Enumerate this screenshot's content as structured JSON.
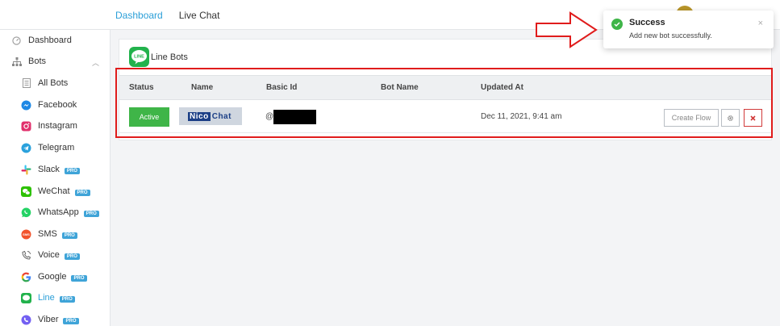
{
  "header": {
    "nav": [
      {
        "label": "Dashboard",
        "active": true
      },
      {
        "label": "Live Chat",
        "active": false
      }
    ]
  },
  "sidebar": {
    "items": [
      {
        "label": "Dashboard",
        "icon": "dashboard-icon"
      },
      {
        "label": "Bots",
        "icon": "sitemap-icon",
        "expanded": true
      },
      {
        "label": "All Bots",
        "icon": "list-icon"
      },
      {
        "label": "Facebook",
        "icon": "messenger-icon"
      },
      {
        "label": "Instagram",
        "icon": "instagram-icon"
      },
      {
        "label": "Telegram",
        "icon": "telegram-icon"
      },
      {
        "label": "Slack",
        "icon": "slack-icon",
        "badge": "PRO"
      },
      {
        "label": "WeChat",
        "icon": "wechat-icon",
        "badge": "PRO"
      },
      {
        "label": "WhatsApp",
        "icon": "whatsapp-icon",
        "badge": "PRO"
      },
      {
        "label": "SMS",
        "icon": "sms-icon",
        "badge": "PRO"
      },
      {
        "label": "Voice",
        "icon": "voice-icon",
        "badge": "PRO"
      },
      {
        "label": "Google",
        "icon": "google-icon",
        "badge": "PRO"
      },
      {
        "label": "Line",
        "icon": "line-icon",
        "badge": "PRO",
        "active": true
      },
      {
        "label": "Viber",
        "icon": "viber-icon",
        "badge": "PRO"
      }
    ]
  },
  "card": {
    "logo_text": "LINE",
    "title": "Line Bots",
    "columns": [
      "Status",
      "Name",
      "Basic Id",
      "Bot Name",
      "Updated At"
    ],
    "rows": [
      {
        "status": "Active",
        "name_logo_part1": "Nico",
        "name_logo_part2": "Chat",
        "basic_id_prefix": "@",
        "updated_at": "Dec 11, 2021, 9:41 am",
        "create_flow_label": "Create Flow"
      }
    ]
  },
  "toast": {
    "title": "Success",
    "message": "Add new bot successfully.",
    "close": "×"
  },
  "colors": {
    "accent": "#2b9fd8",
    "success": "#3fb548",
    "danger": "#d13a3a",
    "annotation": "#e01c1c",
    "line_brand": "#22b24c"
  }
}
